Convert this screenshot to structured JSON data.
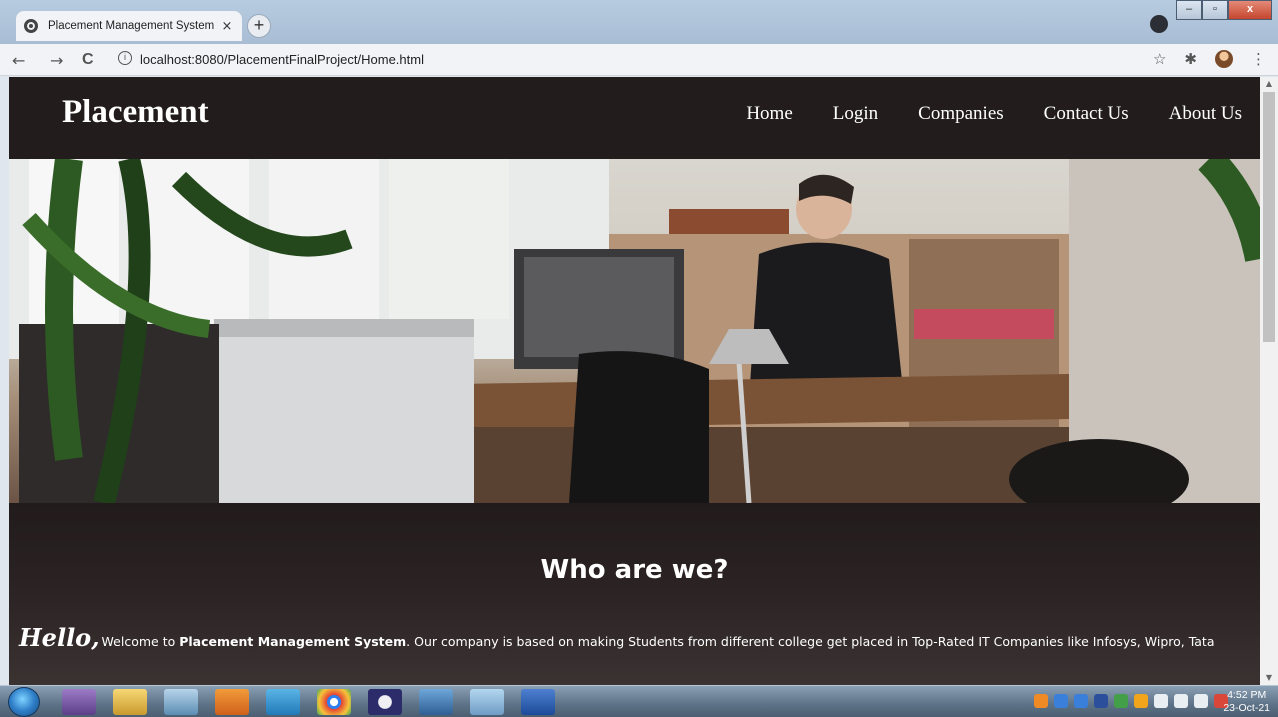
{
  "browser": {
    "tab_title": "Placement Management System",
    "tab_close": "×",
    "new_tab": "+",
    "back": "←",
    "forward": "→",
    "reload": "C",
    "info": "i",
    "url": "localhost:8080/PlacementFinalProject/Home.html",
    "bookmark": "☆",
    "extensions": "✱",
    "menu": "⋮",
    "window_minimize": "–",
    "window_maximize": "▫",
    "window_close": "x"
  },
  "site": {
    "brand": "Placement",
    "nav": [
      "Home",
      "Login",
      "Companies",
      "Contact Us",
      "About Us"
    ],
    "section_title": "Who are we?",
    "intro_hello": "Hello,",
    "intro_prefix": "Welcome to ",
    "intro_strong": "Placement Management System",
    "intro_rest": ". Our company is based on making Students from different college get placed in Top-Rated IT Companies like Infosys, Wipro, Tata"
  },
  "taskbar": {
    "time": "4:52 PM",
    "date": "23-Oct-21"
  },
  "colors": {
    "page_bg": "#221b1b",
    "text": "#ffffff",
    "taskbar": "#5d7287"
  }
}
